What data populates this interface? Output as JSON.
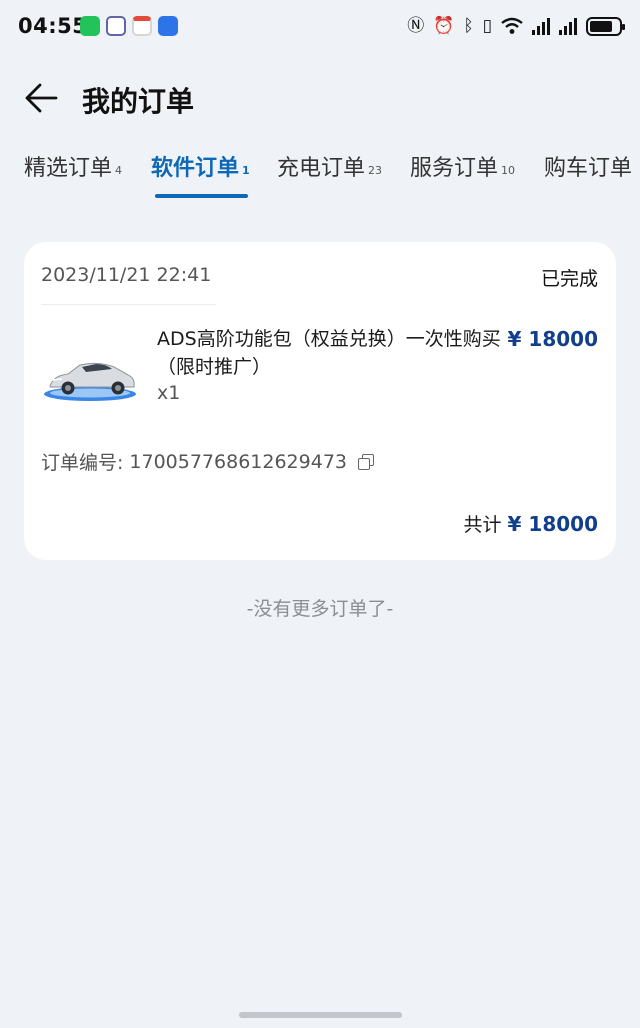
{
  "status_bar": {
    "time": "04:55",
    "app_icons": [
      "wechat-icon",
      "teams-icon",
      "calendar-icon",
      "hicar-icon"
    ],
    "system_icons": [
      "nfc-icon",
      "alarm-icon",
      "bluetooth-icon",
      "vibrate-icon",
      "wifi-icon",
      "signal-icon",
      "signal-icon",
      "battery-icon"
    ]
  },
  "header": {
    "title": "我的订单"
  },
  "tabs": [
    {
      "label": "精选订单",
      "count": "4"
    },
    {
      "label": "软件订单",
      "count": "1"
    },
    {
      "label": "充电订单",
      "count": "23"
    },
    {
      "label": "服务订单",
      "count": "10"
    },
    {
      "label": "购车订单",
      "count": ""
    }
  ],
  "active_tab": "软件订单",
  "order": {
    "date": "2023/11/21 22:41",
    "status": "已完成",
    "product_name": "ADS高阶功能包（权益兑换）一次性购买（限时推广）",
    "price": "¥ 18000",
    "quantity": "x1",
    "order_number_label": "订单编号:",
    "order_number": "17005776861262 9473",
    "total_label": "共计",
    "total_amount": "¥ 18000"
  },
  "footer_text": "-没有更多订单了-",
  "colors": {
    "accent": "#0f68b6",
    "price": "#123f8c",
    "background": "#eff2f6"
  }
}
